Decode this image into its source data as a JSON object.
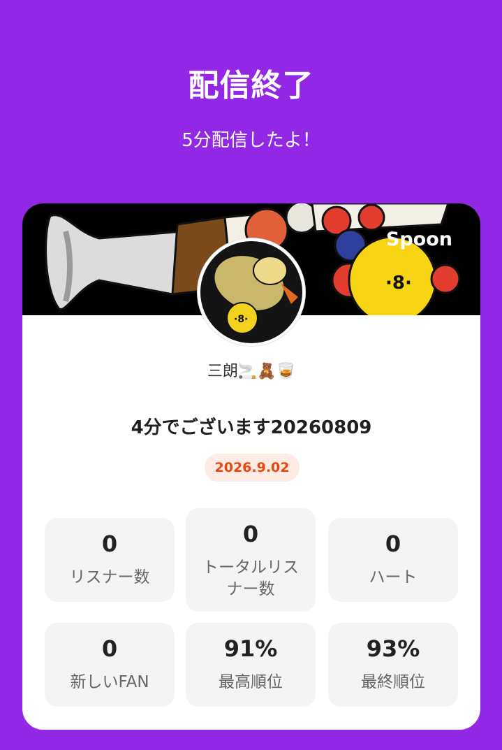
{
  "header": {
    "title": "配信終了",
    "subtitle": "5分配信したよ！"
  },
  "card": {
    "brand": "Spoon",
    "username": "三朗🚬🧸🥃",
    "live_title": "4分でございます20260809",
    "date": "2026.9.02",
    "stats": [
      {
        "value": "0",
        "label": "リスナー数"
      },
      {
        "value": "0",
        "label": "トータルリス ナー数"
      },
      {
        "value": "0",
        "label": "ハート"
      },
      {
        "value": "0",
        "label": "新しいFAN"
      },
      {
        "value": "91%",
        "label": "最高順位"
      },
      {
        "value": "93%",
        "label": "最終順位"
      }
    ]
  },
  "colors": {
    "background": "#9227E6",
    "badge_bg": "#FDEBE4",
    "badge_text": "#E8470E"
  }
}
